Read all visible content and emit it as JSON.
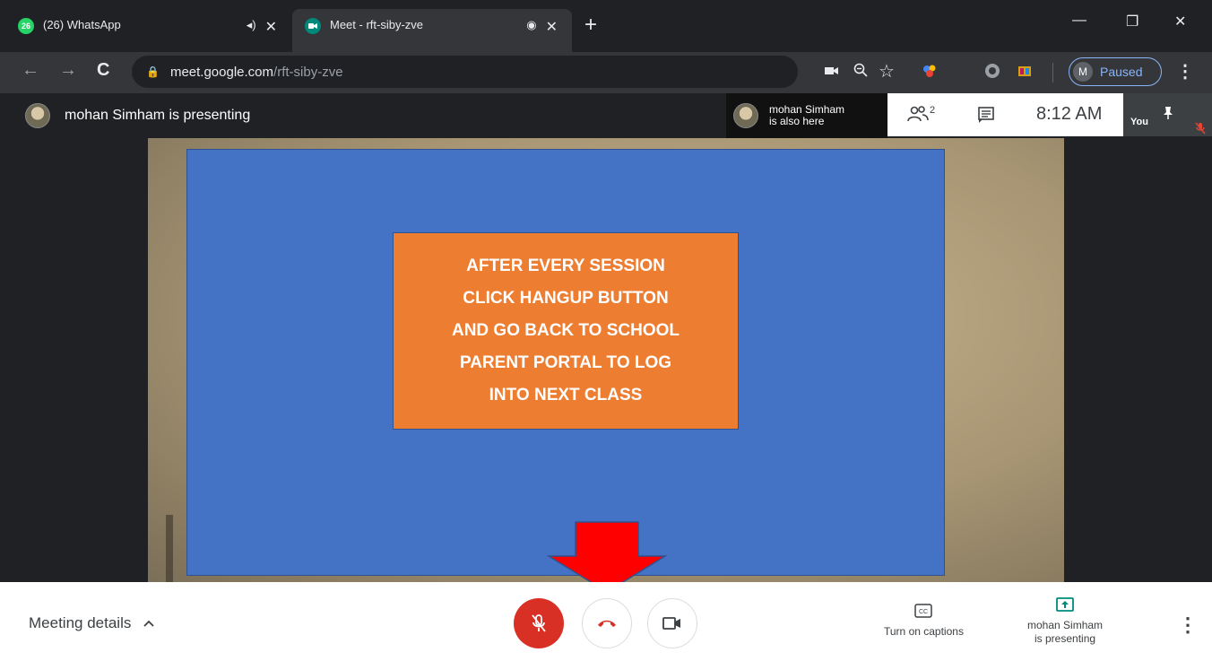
{
  "browser": {
    "tabs": [
      {
        "badge": "26",
        "title": "(26) WhatsApp",
        "indicator": "◂)",
        "close": "✕",
        "favicon_color": "#25d366"
      },
      {
        "badge": "",
        "title": "Meet - rft-siby-zve",
        "indicator": "◉",
        "close": "✕",
        "favicon_color": "#00897b"
      }
    ],
    "new_tab": "+",
    "window_controls": {
      "minimize": "—",
      "restore": "❐",
      "close": "✕"
    },
    "nav": {
      "back": "←",
      "forward": "→",
      "reload": "C"
    },
    "omnibox": {
      "lock": "🔒",
      "domain": "meet.google.com",
      "path": "/rft-siby-zve"
    },
    "toolbar_icons": [
      "camera-icon",
      "zoom-icon",
      "star-icon",
      "extension-icon",
      "extension-icon",
      "extension-icon"
    ],
    "profile": {
      "initial": "M",
      "status": "Paused"
    },
    "menu": "⋮"
  },
  "meet": {
    "presenter_label": "mohan Simham is presenting",
    "also_here": {
      "name": "mohan Simham",
      "note": "is also here"
    },
    "participants_count": "2",
    "time": "8:12 AM",
    "self_label": "You",
    "slide": {
      "lines": [
        "AFTER EVERY SESSION",
        "CLICK HANGUP BUTTON",
        "AND GO BACK TO SCHOOL",
        "PARENT PORTAL TO LOG",
        "INTO NEXT CLASS"
      ],
      "bg": "#4472c4",
      "callout_bg": "#ed7d31",
      "arrow_color": "#ff0000"
    },
    "bottom": {
      "meeting_details": "Meeting details",
      "captions": "Turn on captions",
      "presenting": {
        "name": "mohan Simham",
        "note": "is presenting"
      }
    },
    "colors": {
      "mic_off": "#d93025",
      "hangup": "#d93025",
      "accent": "#00897b"
    }
  }
}
